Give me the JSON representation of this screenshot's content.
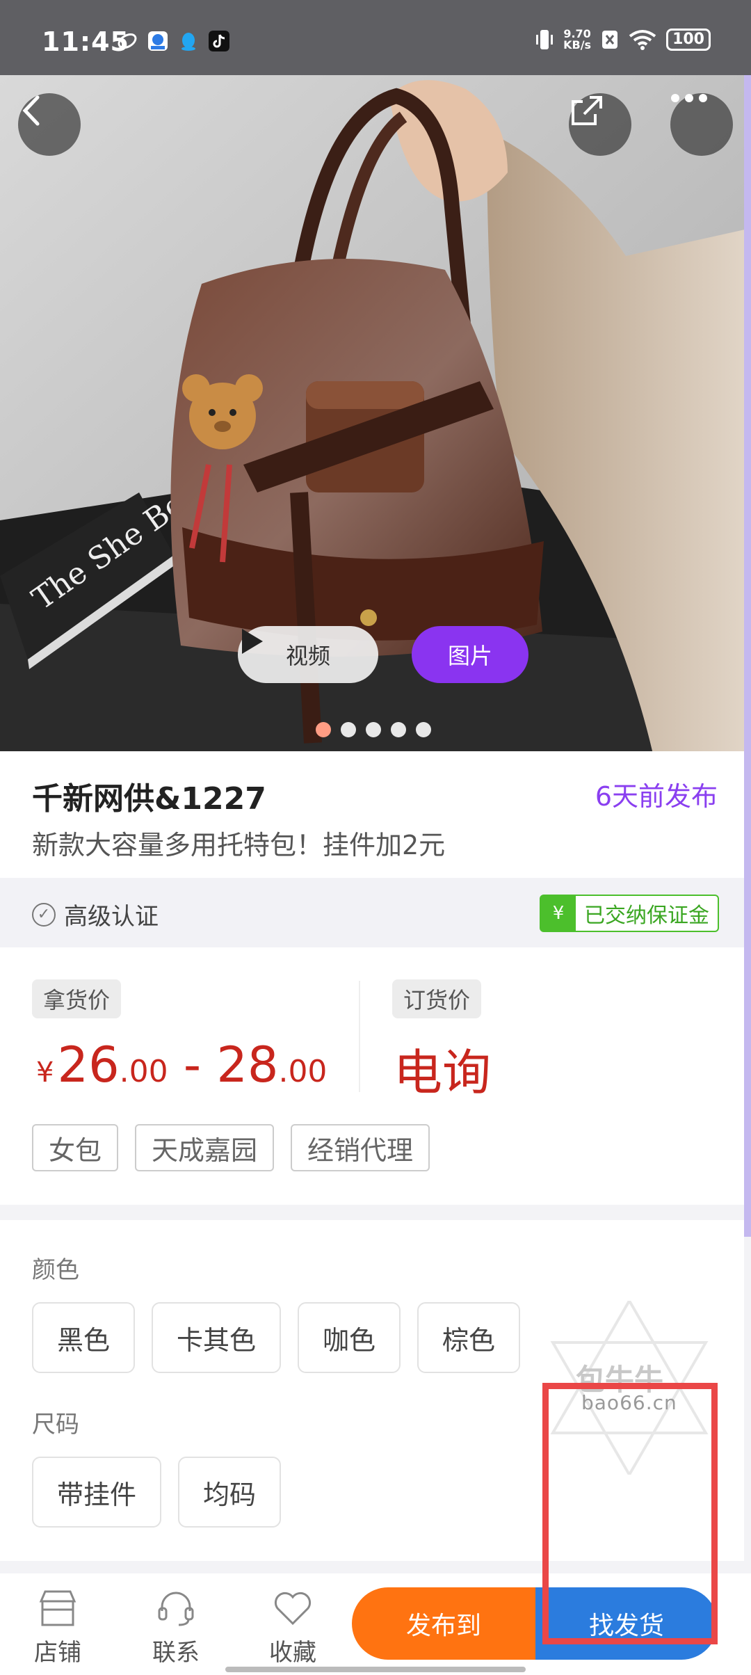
{
  "status_bar": {
    "time": "11:45",
    "speed_value": "9.70",
    "speed_unit": "KB/s",
    "battery": "100",
    "icons": [
      "swirl-app-icon",
      "blue-app-icon",
      "qq-icon",
      "tiktok-icon",
      "vibrate-icon",
      "sim-off-icon",
      "wifi-icon"
    ]
  },
  "hero": {
    "book_title": "The She Book",
    "video_label": "视频",
    "photo_label": "图片",
    "dots_total": 5,
    "dots_active_index": 0
  },
  "listing": {
    "shop_name": "千新网供&1227",
    "posted_time": "6天前发布",
    "description": "新款大容量多用托特包！挂件加2元",
    "certification": "高级认证",
    "deposit_badge": "已交纳保证金"
  },
  "pricing": {
    "pickup_label": "拿货价",
    "pickup_currency": "¥",
    "pickup_min_int": "26",
    "pickup_min_dec": ".00",
    "pickup_sep": " - ",
    "pickup_max_int": "28",
    "pickup_max_dec": ".00",
    "order_label": "订货价",
    "order_value": "电询",
    "tags": [
      "女包",
      "天成嘉园",
      "经销代理"
    ]
  },
  "specs": {
    "color_label": "颜色",
    "colors": [
      "黑色",
      "卡其色",
      "咖色",
      "棕色"
    ],
    "size_label": "尺码",
    "sizes": [
      "带挂件",
      "均码"
    ]
  },
  "watermark": {
    "logo_text": "包牛牛",
    "domain": "bao66.cn"
  },
  "bottom_bar": {
    "store_label": "店铺",
    "contact_label": "联系",
    "favorite_label": "收藏",
    "publish_label": "发布到",
    "find_label": "找发货"
  },
  "colors": {
    "accent_purple": "#8a34f0",
    "price_red": "#c8261d",
    "publish_orange": "#ff7311",
    "find_blue": "#2b7cde",
    "deposit_green": "#4cbf2c",
    "highlight_red": "#ea4747"
  }
}
